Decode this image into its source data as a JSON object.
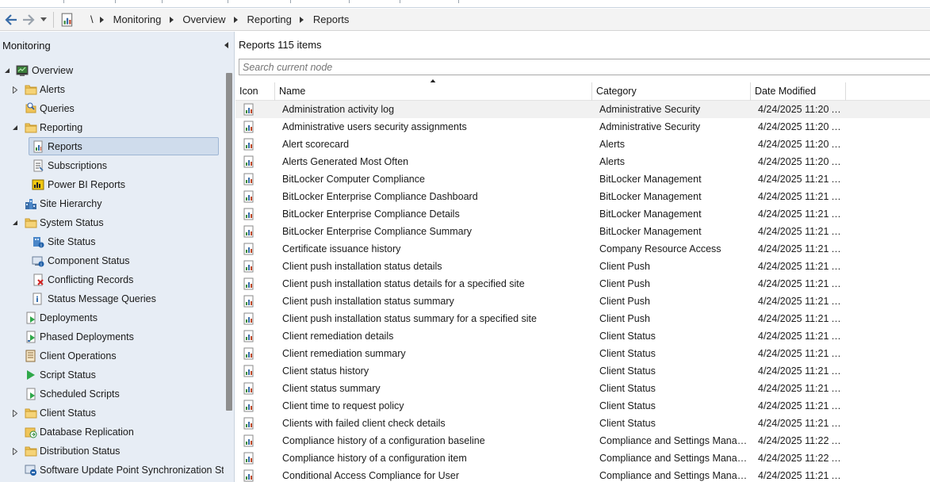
{
  "address_bar": {
    "root_symbol": "\\",
    "crumbs": [
      "Monitoring",
      "Overview",
      "Reporting",
      "Reports"
    ]
  },
  "left_pane": {
    "title": "Monitoring",
    "tree": [
      {
        "label": "Overview",
        "icon": "overview-icon",
        "expander": "expanded",
        "level": 0
      },
      {
        "label": "Alerts",
        "icon": "folder-icon",
        "expander": "collapsed",
        "level": 1
      },
      {
        "label": "Queries",
        "icon": "queries-icon",
        "expander": "none",
        "level": 1
      },
      {
        "label": "Reporting",
        "icon": "folder-icon",
        "expander": "expanded",
        "level": 1
      },
      {
        "label": "Reports",
        "icon": "report-icon",
        "expander": "none",
        "level": 2,
        "selected": true
      },
      {
        "label": "Subscriptions",
        "icon": "subscriptions-icon",
        "expander": "none",
        "level": 2
      },
      {
        "label": "Power BI Reports",
        "icon": "powerbi-icon",
        "expander": "none",
        "level": 2
      },
      {
        "label": "Site Hierarchy",
        "icon": "site-hierarchy-icon",
        "expander": "none",
        "level": 1
      },
      {
        "label": "System Status",
        "icon": "folder-icon",
        "expander": "expanded",
        "level": 1
      },
      {
        "label": "Site Status",
        "icon": "site-status-icon",
        "expander": "none",
        "level": 2
      },
      {
        "label": "Component Status",
        "icon": "component-status-icon",
        "expander": "none",
        "level": 2
      },
      {
        "label": "Conflicting Records",
        "icon": "conflicting-records-icon",
        "expander": "none",
        "level": 2
      },
      {
        "label": "Status Message Queries",
        "icon": "status-message-icon",
        "expander": "none",
        "level": 2
      },
      {
        "label": "Deployments",
        "icon": "deployments-icon",
        "expander": "none",
        "level": 1
      },
      {
        "label": "Phased Deployments",
        "icon": "phased-deployments-icon",
        "expander": "none",
        "level": 1
      },
      {
        "label": "Client Operations",
        "icon": "client-operations-icon",
        "expander": "none",
        "level": 1
      },
      {
        "label": "Script Status",
        "icon": "script-status-icon",
        "expander": "none",
        "level": 1
      },
      {
        "label": "Scheduled Scripts",
        "icon": "scheduled-scripts-icon",
        "expander": "none",
        "level": 1
      },
      {
        "label": "Client Status",
        "icon": "folder-icon",
        "expander": "collapsed",
        "level": 1
      },
      {
        "label": "Database Replication",
        "icon": "database-replication-icon",
        "expander": "none",
        "level": 1
      },
      {
        "label": "Distribution Status",
        "icon": "folder-icon",
        "expander": "collapsed",
        "level": 1
      },
      {
        "label": "Software Update Point Synchronization Sta",
        "icon": "sup-sync-icon",
        "expander": "none",
        "level": 1
      }
    ]
  },
  "right_pane": {
    "title": "Reports 115 items",
    "search_placeholder": "Search current node",
    "columns": {
      "icon": "Icon",
      "name": "Name",
      "category": "Category",
      "date": "Date Modified"
    },
    "rows": [
      {
        "name": "Administration activity log",
        "category": "Administrative Security",
        "date": "4/24/2025 11:20 A..."
      },
      {
        "name": "Administrative users security assignments",
        "category": "Administrative Security",
        "date": "4/24/2025 11:20 A..."
      },
      {
        "name": "Alert scorecard",
        "category": "Alerts",
        "date": "4/24/2025 11:20 A..."
      },
      {
        "name": "Alerts Generated Most Often",
        "category": "Alerts",
        "date": "4/24/2025 11:20 A..."
      },
      {
        "name": "BitLocker Computer Compliance",
        "category": "BitLocker Management",
        "date": "4/24/2025 11:21 A..."
      },
      {
        "name": "BitLocker Enterprise Compliance Dashboard",
        "category": "BitLocker Management",
        "date": "4/24/2025 11:21 A..."
      },
      {
        "name": "BitLocker Enterprise Compliance Details",
        "category": "BitLocker Management",
        "date": "4/24/2025 11:21 A..."
      },
      {
        "name": "BitLocker Enterprise Compliance Summary",
        "category": "BitLocker Management",
        "date": "4/24/2025 11:21 A..."
      },
      {
        "name": "Certificate issuance history",
        "category": "Company Resource Access",
        "date": "4/24/2025 11:21 A..."
      },
      {
        "name": "Client push installation status details",
        "category": "Client Push",
        "date": "4/24/2025 11:21 A..."
      },
      {
        "name": "Client push installation status details for a specified site",
        "category": "Client Push",
        "date": "4/24/2025 11:21 A..."
      },
      {
        "name": "Client push installation status summary",
        "category": "Client Push",
        "date": "4/24/2025 11:21 A..."
      },
      {
        "name": "Client push installation status summary for a specified site",
        "category": "Client Push",
        "date": "4/24/2025 11:21 A..."
      },
      {
        "name": "Client remediation details",
        "category": "Client Status",
        "date": "4/24/2025 11:21 A..."
      },
      {
        "name": "Client remediation summary",
        "category": "Client Status",
        "date": "4/24/2025 11:21 A..."
      },
      {
        "name": "Client status history",
        "category": "Client Status",
        "date": "4/24/2025 11:21 A..."
      },
      {
        "name": "Client status summary",
        "category": "Client Status",
        "date": "4/24/2025 11:21 A..."
      },
      {
        "name": "Client time to request policy",
        "category": "Client Status",
        "date": "4/24/2025 11:21 A..."
      },
      {
        "name": "Clients with failed client check details",
        "category": "Client Status",
        "date": "4/24/2025 11:21 A..."
      },
      {
        "name": "Compliance history of a configuration baseline",
        "category": "Compliance and Settings Manage...",
        "date": "4/24/2025 11:22 A..."
      },
      {
        "name": "Compliance history of a configuration item",
        "category": "Compliance and Settings Manage...",
        "date": "4/24/2025 11:22 A..."
      },
      {
        "name": "Conditional Access Compliance for User",
        "category": "Compliance and Settings Manage...",
        "date": "4/24/2025 11:21 A..."
      }
    ]
  },
  "colors": {
    "nav_pane_bg": "#e7edf5",
    "selection_bg": "#cfdcec",
    "selection_border": "#9eb6d4",
    "folder": "#e8b84a",
    "accent_blue": "#1f5fa8"
  }
}
